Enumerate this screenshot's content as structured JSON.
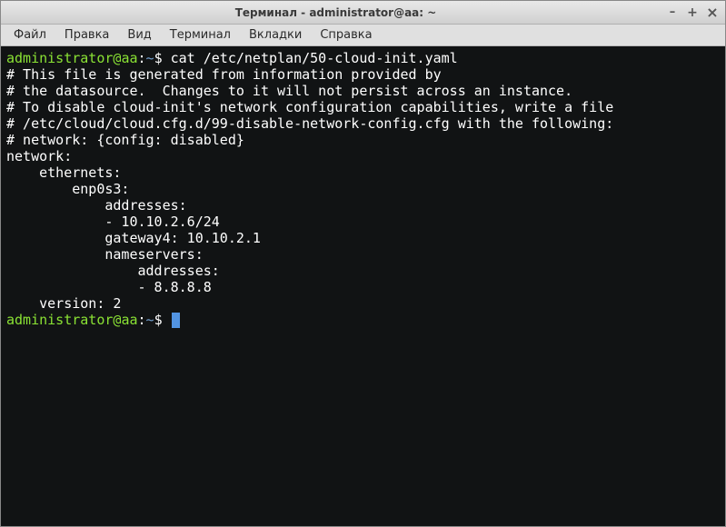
{
  "window": {
    "title": "Терминал - administrator@aa: ~"
  },
  "menubar": {
    "items": [
      "Файл",
      "Правка",
      "Вид",
      "Терминал",
      "Вкладки",
      "Справка"
    ]
  },
  "prompt": {
    "user": "administrator",
    "host": "aa",
    "path": "~",
    "symbol": "$"
  },
  "command": "cat /etc/netplan/50-cloud-init.yaml",
  "output_lines": [
    "# This file is generated from information provided by",
    "# the datasource.  Changes to it will not persist across an instance.",
    "# To disable cloud-init's network configuration capabilities, write a file",
    "# /etc/cloud/cloud.cfg.d/99-disable-network-config.cfg with the following:",
    "# network: {config: disabled}",
    "network:",
    "    ethernets:",
    "        enp0s3:",
    "            addresses:",
    "            - 10.10.2.6/24",
    "            gateway4: 10.10.2.1",
    "            nameservers:",
    "                addresses:",
    "                - 8.8.8.8",
    "    version: 2"
  ]
}
